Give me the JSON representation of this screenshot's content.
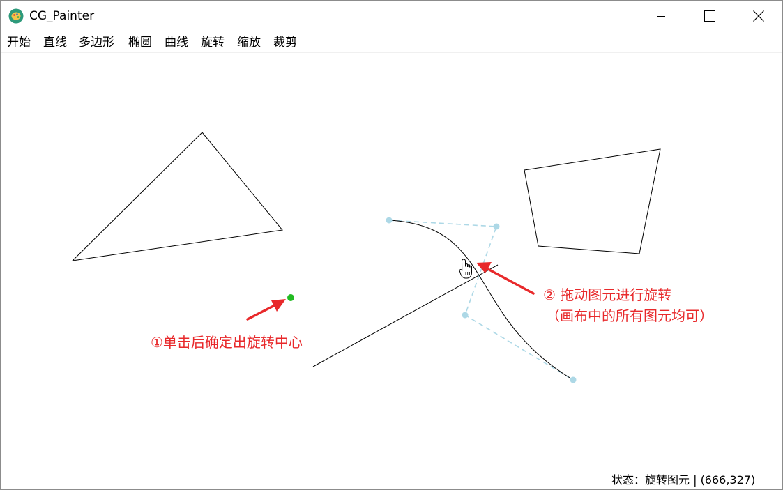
{
  "window": {
    "title": "CG_Painter",
    "icons": {
      "app": "paint-palette-icon",
      "minimize": "minimize-icon",
      "maximize": "maximize-icon",
      "close": "close-icon"
    }
  },
  "menu": {
    "items": [
      "开始",
      "直线",
      "多边形",
      "椭圆",
      "曲线",
      "旋转",
      "缩放",
      "裁剪"
    ]
  },
  "annotations": {
    "step1": "①单击后确定出旋转中心",
    "step2_line1": "② 拖动图元进行旋转",
    "step2_line2": "（画布中的所有图元均可）"
  },
  "status": {
    "text": "状态：旋转图元 | (666,327)"
  },
  "colors": {
    "annotation": "#e8292b",
    "rotation_center": "#22bb22",
    "control_points": "#add8e6",
    "shapes": "#000000"
  }
}
